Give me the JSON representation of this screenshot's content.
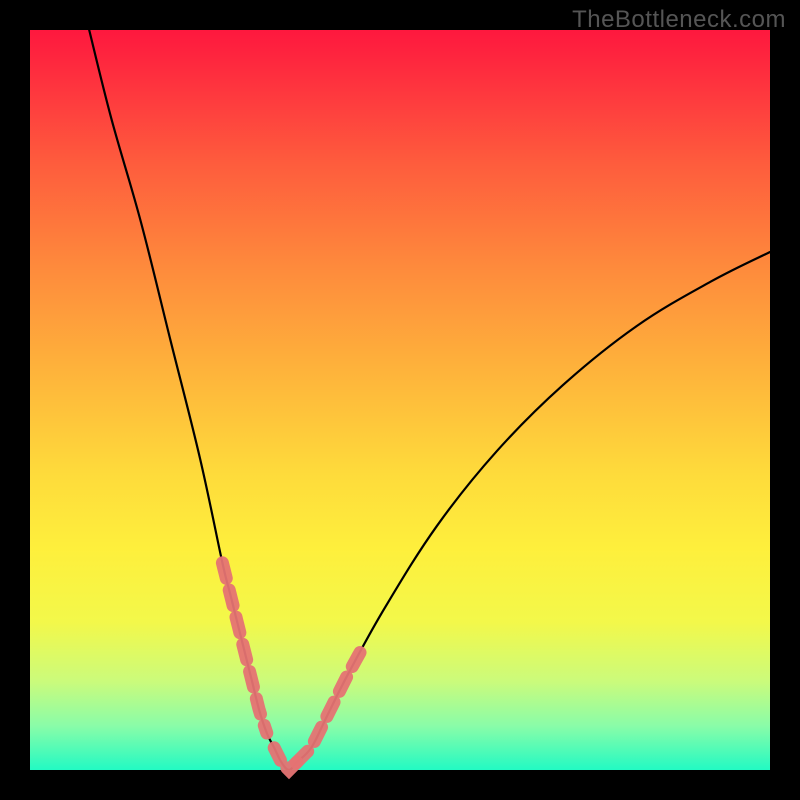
{
  "watermark": "TheBottleneck.com",
  "chart_data": {
    "type": "line",
    "title": "",
    "xlabel": "",
    "ylabel": "",
    "xlim": [
      0,
      100
    ],
    "ylim": [
      0,
      100
    ],
    "series": [
      {
        "name": "bottleneck-curve",
        "x": [
          8,
          11,
          15,
          19,
          23,
          26,
          27,
          28,
          29,
          30,
          31,
          32,
          33,
          34,
          35,
          36,
          38,
          40,
          43,
          48,
          55,
          63,
          72,
          82,
          92,
          100
        ],
        "values": [
          100,
          88,
          74,
          58,
          42,
          28,
          24,
          20,
          16,
          12,
          8,
          5,
          3,
          1,
          0,
          1,
          3,
          7,
          13,
          22,
          33,
          43,
          52,
          60,
          66,
          70
        ]
      }
    ],
    "highlight_segments": [
      {
        "x_from": 26,
        "x_to": 32,
        "note": "left-descent-dots"
      },
      {
        "x_from": 36,
        "x_to": 45,
        "note": "right-ascent-dots"
      }
    ],
    "gradient_stops": [
      {
        "pos": 0.0,
        "color": "#fe183e"
      },
      {
        "pos": 0.3,
        "color": "#fe8a3c"
      },
      {
        "pos": 0.65,
        "color": "#feef3c"
      },
      {
        "pos": 0.88,
        "color": "#cbfb7b"
      },
      {
        "pos": 1.0,
        "color": "#22fac3"
      }
    ]
  }
}
